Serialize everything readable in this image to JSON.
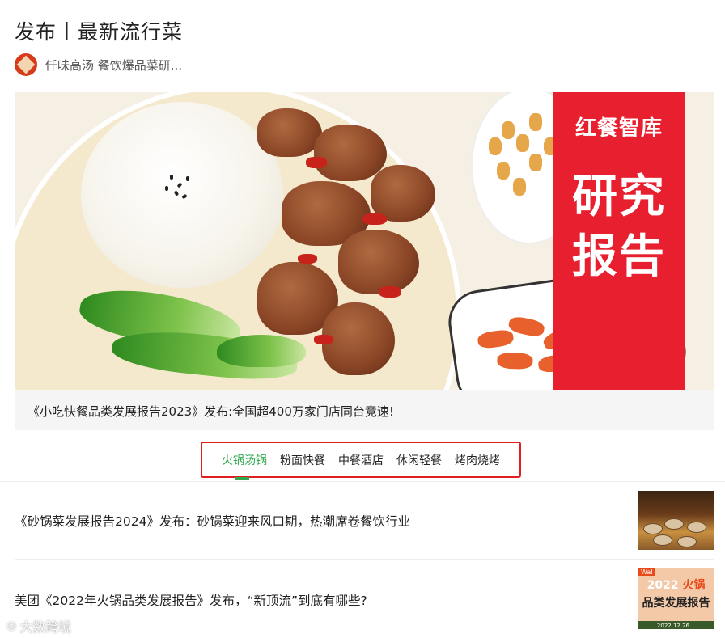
{
  "header": {
    "title": "发布丨最新流行菜",
    "author": "仟味高汤 餐饮爆品菜研..."
  },
  "banner": {
    "brand": "红餐智库",
    "headline_1": "研究",
    "headline_2": "报告",
    "caption": "《小吃快餐品类发展报告2023》发布:全国超400万家门店同台竞速!"
  },
  "tabs": {
    "items": [
      "火锅汤锅",
      "粉面快餐",
      "中餐酒店",
      "休闲轻餐",
      "烤肉烧烤"
    ],
    "active_index": 0
  },
  "articles": [
    {
      "title": "《砂锅菜发展报告2024》发布：砂锅菜迎来风口期，热潮席卷餐饮行业"
    },
    {
      "title": "美团《2022年火锅品类发展报告》发布，“新顶流”到底有哪些?",
      "thumb_line_1_a": "2022",
      "thumb_line_1_b": "火锅",
      "thumb_line_2": "品类发展报告",
      "thumb_tag": "Wal",
      "thumb_date": "2022.12.26"
    }
  ],
  "watermark": "大数跨境",
  "colors": {
    "active_tab": "#2fa84f",
    "highlight_border": "#e02020",
    "banner_red": "#e81f2e"
  },
  "icons": [
    "author-avatar-icon",
    "watermark-logo-icon"
  ]
}
